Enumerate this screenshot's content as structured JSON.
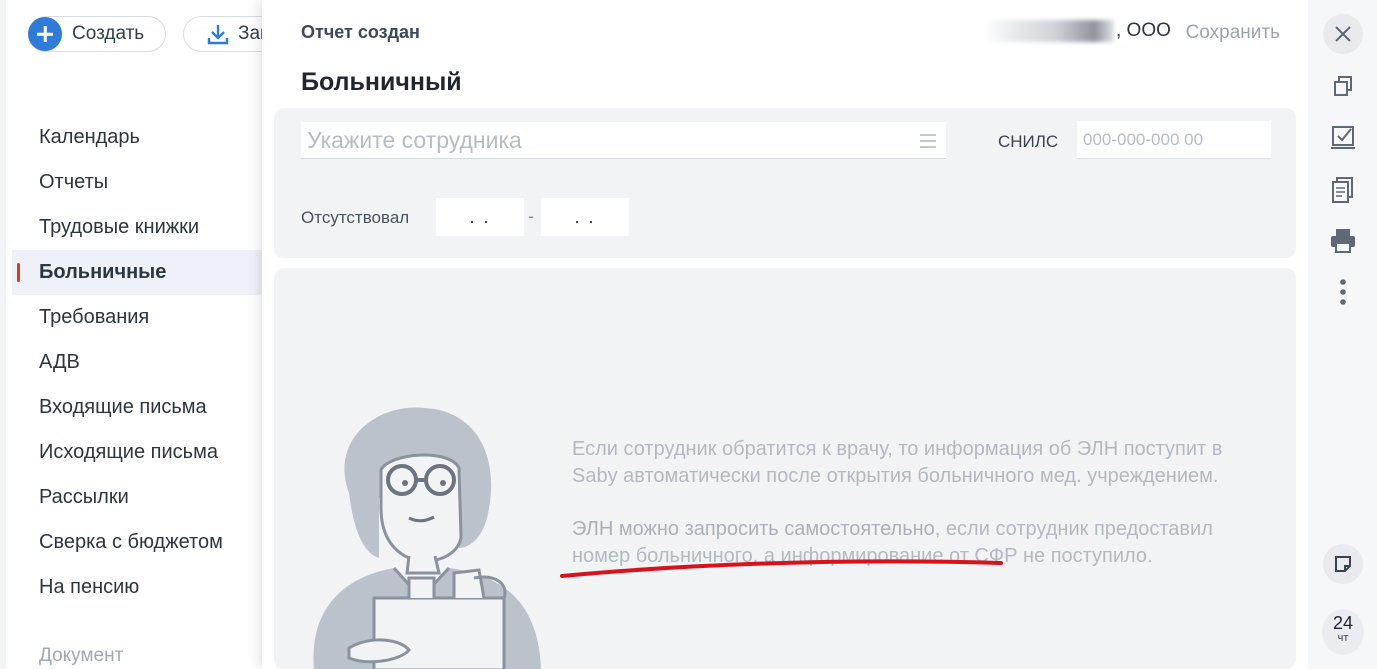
{
  "left": {
    "create_label": "Создать",
    "load_label": "Заг",
    "nav": [
      {
        "label": "Календарь",
        "active": false
      },
      {
        "label": "Отчеты",
        "active": false
      },
      {
        "label": "Трудовые книжки",
        "active": false
      },
      {
        "label": "Больничные",
        "active": true
      },
      {
        "label": "Требования",
        "active": false
      },
      {
        "label": "АДВ",
        "active": false
      },
      {
        "label": "Входящие письма",
        "active": false
      },
      {
        "label": "Исходящие письма",
        "active": false
      },
      {
        "label": "Рассылки",
        "active": false
      },
      {
        "label": "Сверка с бюджетом",
        "active": false
      },
      {
        "label": "На пенсию",
        "active": false
      }
    ],
    "section_label": "Документ"
  },
  "panel": {
    "status": "Отчет создан",
    "org_suffix": ", ООО",
    "save_label": "Сохранить",
    "title": "Больничный",
    "employee_placeholder": "Укажите сотрудника",
    "snils_label": "СНИЛС",
    "snils_placeholder": "000-000-000 00",
    "absent_label": "Отсутствовал",
    "date_from": ". .",
    "date_to": ". .",
    "date_separator": "-",
    "info_paragraph_1": "Если сотрудник обратится к врачу, то информация об ЭЛН поступит в Saby автоматически после открытия больничного мед. учреждением.",
    "info_highlight": "ЭЛН можно запросить самостоятельно",
    "info_paragraph_2_rest": ", если сотрудник предоставил номер больничного, а информирование от СФР не поступило.",
    "annotation_color": "#d8111a"
  },
  "toolbar": {
    "icons": [
      "close-icon",
      "copy-icon",
      "checklist-icon",
      "document-icon",
      "print-icon",
      "more-icon",
      "note-icon"
    ],
    "day": "24",
    "weekday": "чт"
  }
}
